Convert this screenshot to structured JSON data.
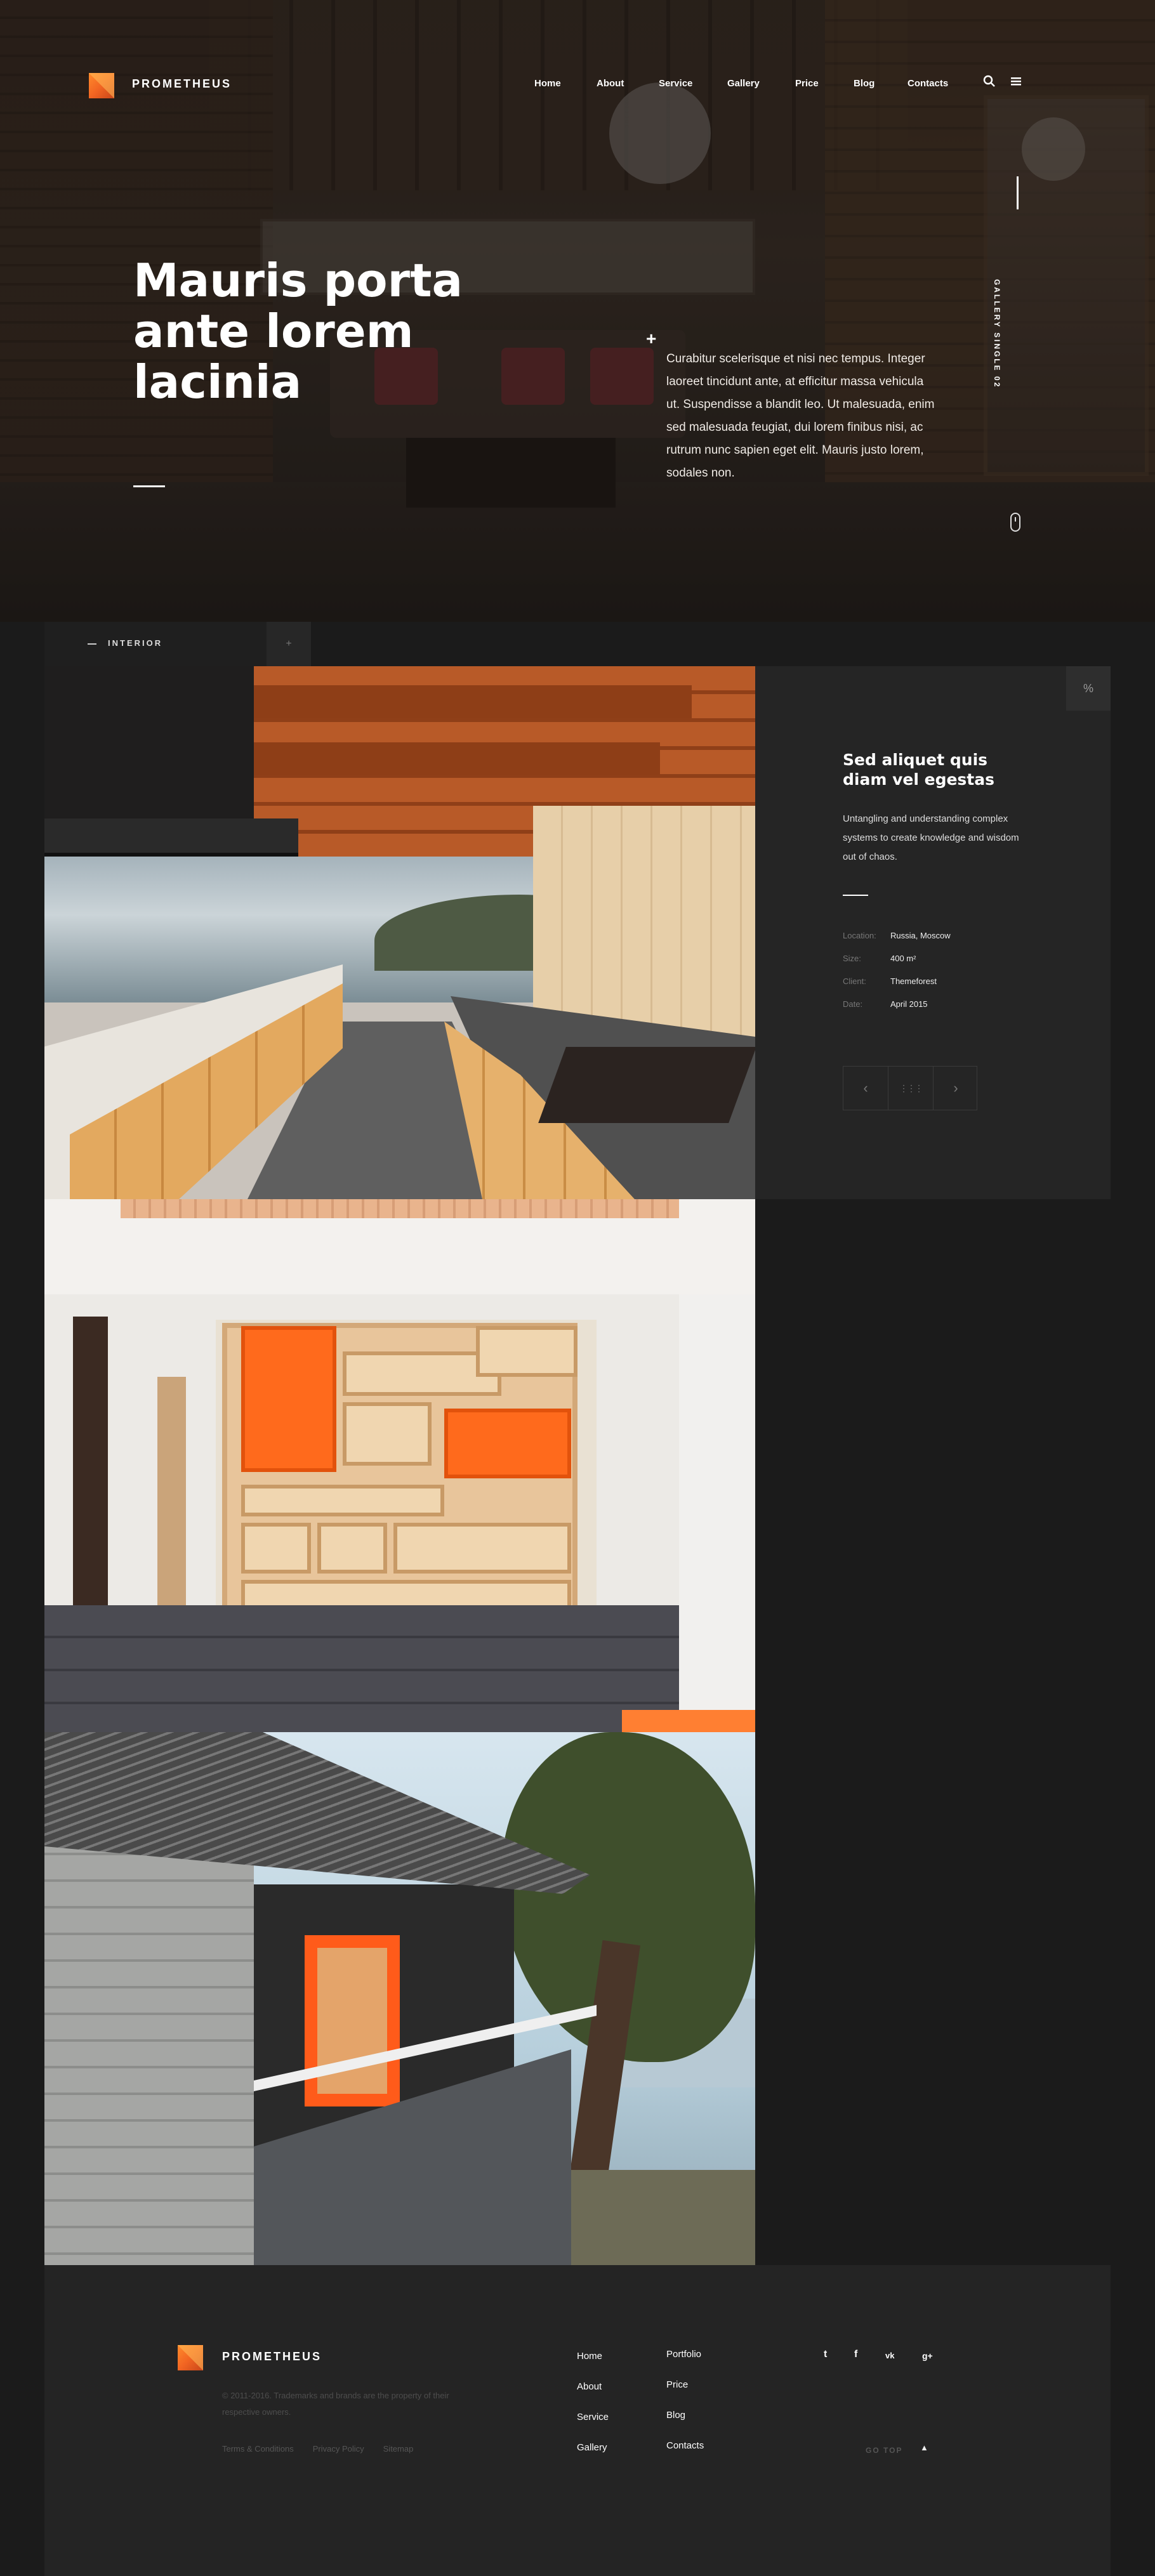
{
  "brand": {
    "name": "PROMETHEUS",
    "accent": "#f26522"
  },
  "nav": {
    "items": [
      "Home",
      "About",
      "Service",
      "Gallery",
      "Price",
      "Blog",
      "Contacts"
    ],
    "icons": [
      "search-icon",
      "menu-icon"
    ]
  },
  "hero": {
    "title": "Mauris porta ante lorem lacinia",
    "plus": "+",
    "text": "Curabitur scelerisque et nisi nec tempus. Integer laoreet tincidunt ante, at efficitur massa vehicula ut. Suspendisse a blandit leo. Ut malesuada, enim sed malesuada feugiat, dui lorem finibus nisi, ac rutrum nunc sapien eget elit. Mauris justo lorem, sodales non.",
    "side_label": "GALLERY SINGLE 02"
  },
  "filter": {
    "dash": "—",
    "label": "INTERIOR",
    "toggle": "+"
  },
  "project": {
    "title": "Sed aliquet quis diam vel egestas",
    "description": "Untangling and understanding complex systems to create knowledge and wisdom out of chaos.",
    "meta": [
      {
        "key": "Location:",
        "value": "Russia, Moscow"
      },
      {
        "key": "Size:",
        "value": "400 m²"
      },
      {
        "key": "Client:",
        "value": "Themeforest"
      },
      {
        "key": "Date:",
        "value": "April 2015"
      }
    ],
    "link_icon": "%",
    "pager": {
      "prev": "‹",
      "grid": "⋮⋮⋮",
      "next": "›"
    }
  },
  "footer": {
    "brand": "PROMETHEUS",
    "copyright": "© 2011-2016. Trademarks and brands are the property of their respective owners.",
    "links": [
      "Terms & Conditions",
      "Privacy Policy",
      "Sitemap"
    ],
    "nav_col1": [
      "Home",
      "About",
      "Service",
      "Gallery"
    ],
    "nav_col2": [
      "Portfolio",
      "Price",
      "Blog",
      "Contacts"
    ],
    "social": [
      "twitter-icon",
      "facebook-icon",
      "vk-icon",
      "google-plus-icon"
    ],
    "social_glyphs": [
      "t",
      "f",
      "vk",
      "g+"
    ],
    "go_top": "GO TOP",
    "go_top_arrow": "▲"
  }
}
